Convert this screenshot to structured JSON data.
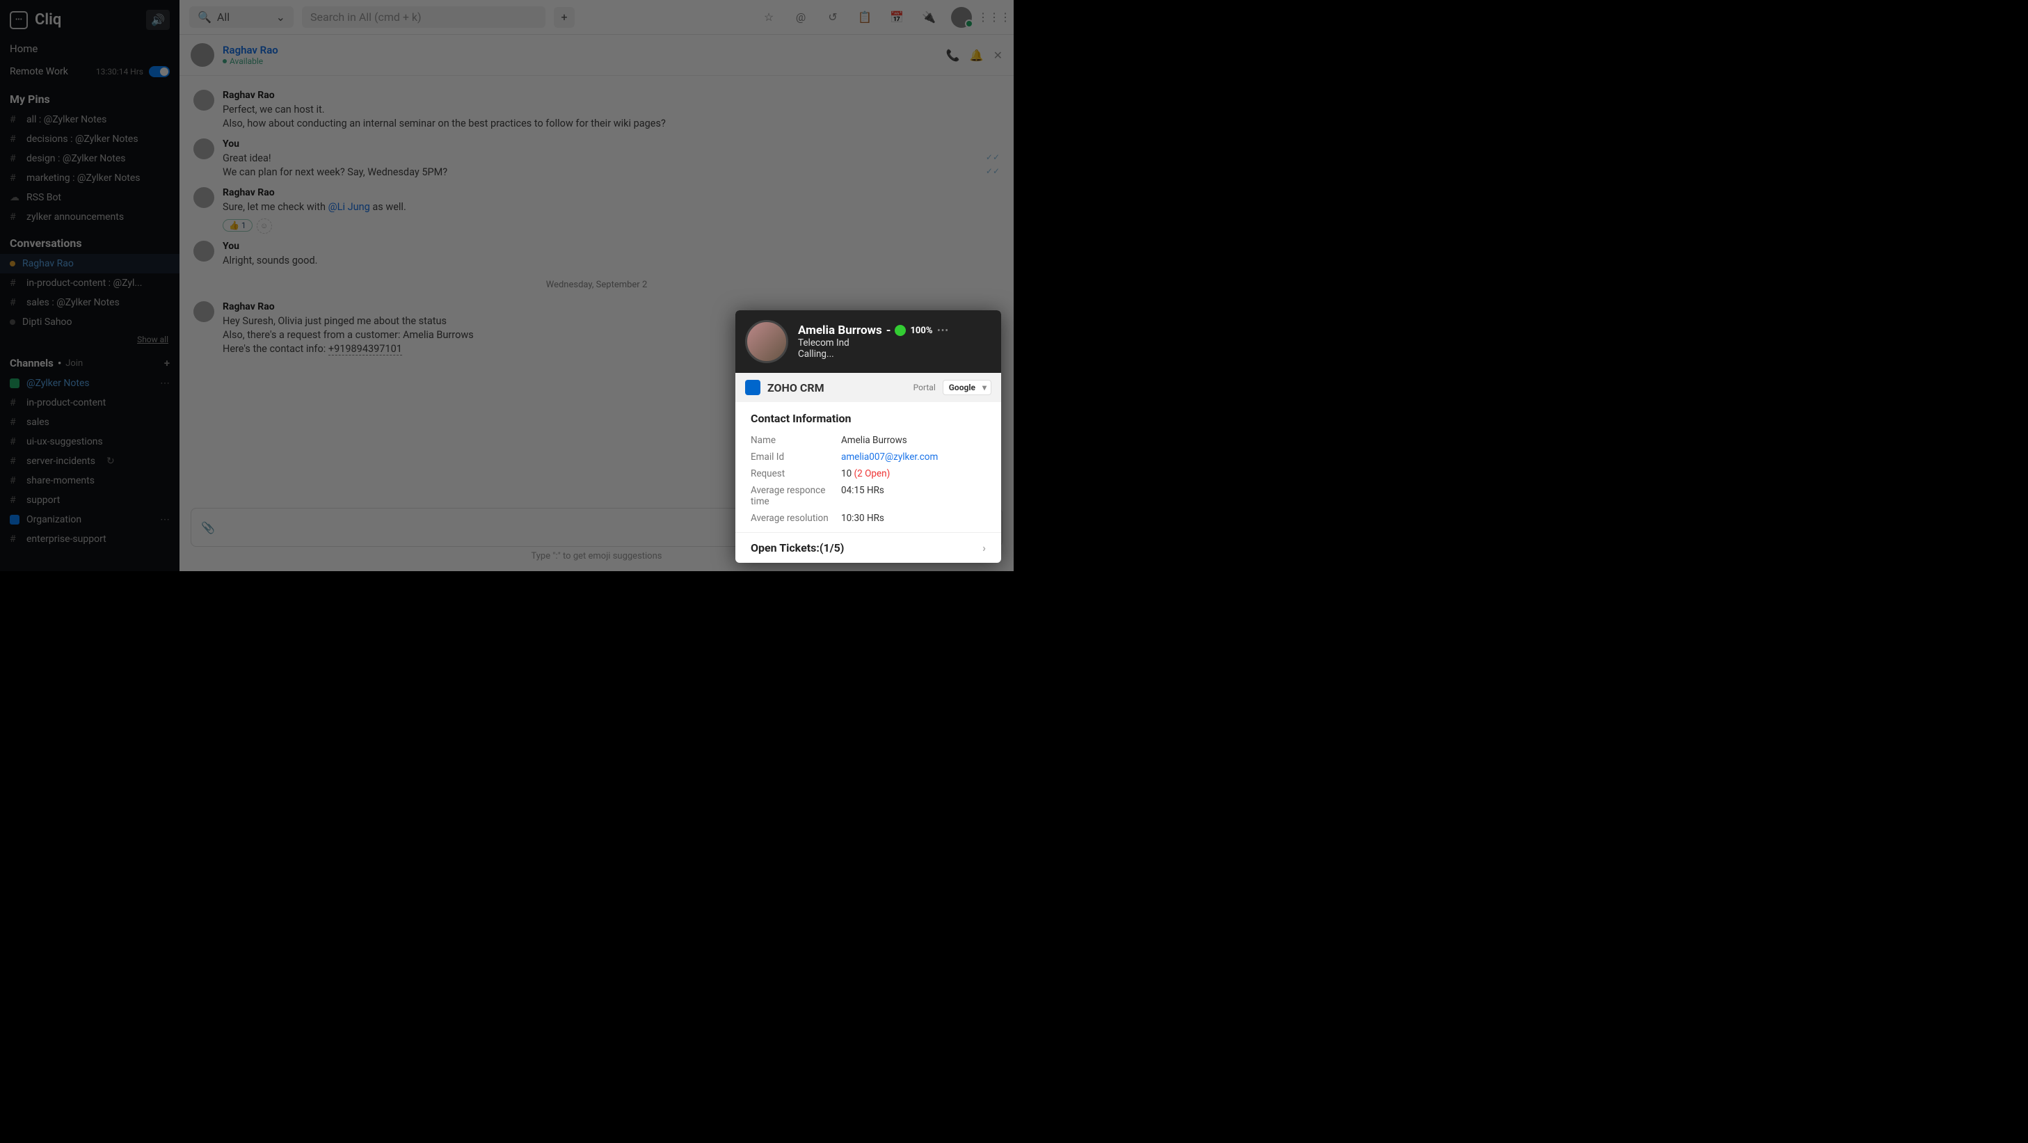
{
  "brand": "Cliq",
  "sidebar": {
    "home": "Home",
    "remote": "Remote Work",
    "timer": "13:30:14 Hrs",
    "pins_h": "My Pins",
    "pins": [
      "all : @Zylker Notes",
      "decisions : @Zylker Notes",
      "design : @Zylker Notes",
      "marketing : @Zylker Notes",
      "RSS Bot",
      "zylker announcements"
    ],
    "conv_h": "Conversations",
    "convs": [
      {
        "label": "Raghav Rao",
        "dot": "amber",
        "active": true
      },
      {
        "label": "in-product-content : @Zyl...",
        "hash": true
      },
      {
        "label": "sales : @Zylker Notes",
        "hash": true
      },
      {
        "label": "Dipti Sahoo",
        "dot": "grey"
      }
    ],
    "showall": "Show all",
    "channels_h": "Channels",
    "join": "Join",
    "channels": [
      {
        "label": "@Zylker Notes",
        "sq": "#2a6",
        "sel": true,
        "dots": true
      },
      {
        "label": "in-product-content"
      },
      {
        "label": "sales"
      },
      {
        "label": "ui-ux-suggestions"
      },
      {
        "label": "server-incidents",
        "loop": true
      },
      {
        "label": "share-moments"
      },
      {
        "label": "support"
      },
      {
        "label": "Organization",
        "sq": "#0a84ff",
        "dots": true
      },
      {
        "label": "enterprise-support"
      }
    ]
  },
  "topbar": {
    "all": "All",
    "search_ph": "Search in All (cmd + k)"
  },
  "chat": {
    "name": "Raghav Rao",
    "status": "Available",
    "messages": [
      {
        "sender": "Raghav Rao",
        "lines": [
          "Perfect, we can host it.",
          "Also, how about conducting an internal seminar on the best practices to follow for their wiki pages?"
        ]
      },
      {
        "sender": "You",
        "lines": [
          "Great idea!",
          "We can plan for next week? Say, Wednesday 5PM?"
        ],
        "ticks": true
      },
      {
        "sender": "Raghav Rao",
        "lines_html": "Sure, let me check with <span class='mention'>@Li Jung</span>  as well.",
        "reaction": "👍 1"
      },
      {
        "sender": "You",
        "lines": [
          "Alright, sounds good."
        ]
      }
    ],
    "date": "Wednesday, September 2",
    "after": [
      {
        "sender": "Raghav Rao",
        "lines": [
          "Hey Suresh, Olivia just pinged me about the status",
          "Also, there's a request from a customer: Amelia Burrows"
        ],
        "phone_prefix": "Here's the contact info:  ",
        "phone": "+919894397101"
      }
    ],
    "hint": "Type \":\" to get emoji suggestions"
  },
  "popup": {
    "name": "Amelia Burrows",
    "pct": "100%",
    "company": "Telecom Ind",
    "status": "Calling...",
    "crm": "ZOHO CRM",
    "portal_label": "Portal",
    "portal_value": "Google",
    "contact_h": "Contact Information",
    "rows": [
      {
        "k": "Name",
        "v": "Amelia Burrows"
      },
      {
        "k": "Email Id",
        "v": "amelia007@zylker.com",
        "link": true
      },
      {
        "k": "Request",
        "v": "10",
        "open": "(2 Open)"
      },
      {
        "k": "Average responce time",
        "v": "04:15 HRs"
      },
      {
        "k": "Average resolution",
        "v": "10:30 HRs"
      }
    ],
    "tickets": "Open Tickets:(1/5)"
  }
}
